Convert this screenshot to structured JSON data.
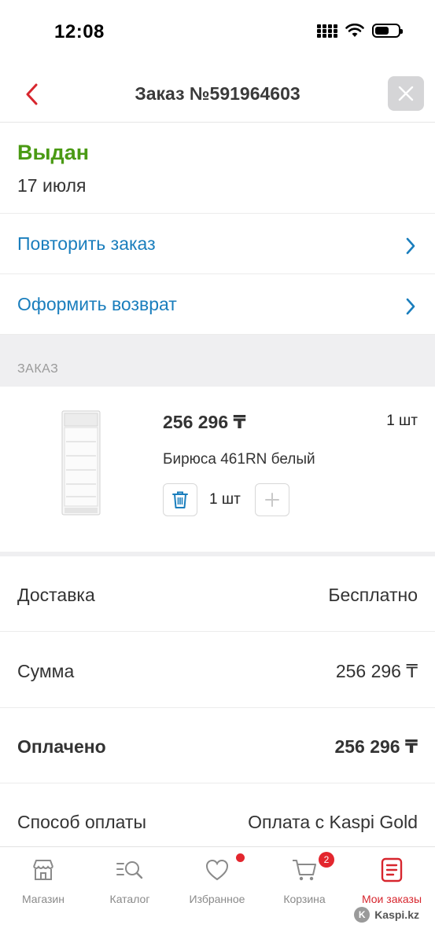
{
  "status_bar": {
    "time": "12:08"
  },
  "header": {
    "title": "Заказ №591964603"
  },
  "order_status": {
    "label": "Выдан",
    "date": "17 июля"
  },
  "actions": [
    {
      "label": "Повторить заказ"
    },
    {
      "label": "Оформить возврат"
    }
  ],
  "section_caption": "ЗАКАЗ",
  "product": {
    "price": "256 296 ₸",
    "quantity": "1 шт",
    "name": "Бирюса 461RN белый",
    "stepper_value": "1 шт"
  },
  "summary": [
    {
      "key": "Доставка",
      "value": "Бесплатно"
    },
    {
      "key": "Сумма",
      "value": "256 296 ₸"
    },
    {
      "key": "Оплачено",
      "value": "256 296 ₸"
    },
    {
      "key": "Способ оплаты",
      "value": "Оплата с Kaspi Gold"
    }
  ],
  "tabbar": {
    "tabs": [
      {
        "label": "Магазин",
        "icon": "shop-icon"
      },
      {
        "label": "Каталог",
        "icon": "catalog-search-icon"
      },
      {
        "label": "Избранное",
        "icon": "heart-icon"
      },
      {
        "label": "Корзина",
        "icon": "cart-icon",
        "badge": "2"
      },
      {
        "label": "Мои заказы",
        "icon": "orders-icon",
        "active": true
      }
    ]
  },
  "watermark": "Kaspi.kz",
  "colors": {
    "accent_red": "#d7262e",
    "status_green": "#4a9a14",
    "link_blue": "#1a7ebd"
  }
}
